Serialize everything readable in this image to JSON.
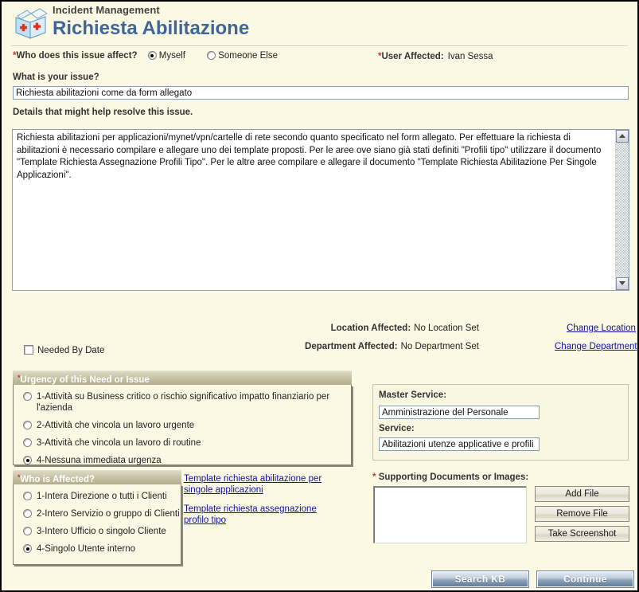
{
  "header": {
    "app_title": "Incident Management",
    "page_title": "Richiesta Abilitazione",
    "logo_icon": "incident-box-icon"
  },
  "affect_row": {
    "question": "Who does this issue affect?",
    "required_star": "*",
    "options": [
      {
        "label": "Myself",
        "selected": true
      },
      {
        "label": "Someone Else",
        "selected": false
      }
    ]
  },
  "user_affected": {
    "required_star": "*",
    "label": "User Affected:",
    "value": "Ivan Sessa"
  },
  "issue": {
    "label": "What is your issue?",
    "value": "Richiesta abilitazioni come da form allegato",
    "placeholder": ""
  },
  "details": {
    "label": "Details that might help resolve this issue.",
    "value": "Richiesta abilitazioni per applicazioni/mynet/vpn/cartelle di rete secondo quanto specificato nel form allegato. Per effettuare la richiesta di abilitazioni è necessario compilare e allegare uno dei template proposti. Per le aree ove siano già stati definiti \"Profili tipo\" utilizzare il documento \"Template Richiesta Assegnazione Profili Tipo\". Per le altre aree compilare e allegare il documento \"Template Richiesta Abilitazione Per Singole Applicazioni\".",
    "scrollbar": {
      "up_icon": "scroll-up-arrow-icon",
      "down_icon": "scroll-down-arrow-icon"
    }
  },
  "location": {
    "label": "Location Affected:",
    "value": "No Location Set",
    "change_link": "Change Location"
  },
  "department": {
    "label": "Department Affected:",
    "value": "No Department Set",
    "change_link": "Change Department"
  },
  "needed_by": {
    "label": "Needed By Date",
    "checked": false
  },
  "urgency": {
    "required_star": "*",
    "title": "Urgency of this Need or Issue",
    "options": [
      {
        "label": "1-Attività su Business critico o rischio significativo impatto finanziario per l'azienda",
        "selected": false
      },
      {
        "label": "2-Attività che vincola un lavoro urgente",
        "selected": false
      },
      {
        "label": "3-Attività che vincola un lavoro di routine",
        "selected": false
      },
      {
        "label": "4-Nessuna immediata urgenza",
        "selected": true
      }
    ]
  },
  "who_affected": {
    "required_star": "*",
    "title": "Who is Affected?",
    "options": [
      {
        "label": "1-Intera Direzione o tutti i Clienti",
        "selected": false
      },
      {
        "label": "2-Intero Servizio o gruppo di Clienti",
        "selected": false
      },
      {
        "label": "3-Intero Ufficio o singolo Cliente",
        "selected": false
      },
      {
        "label": "4-Singolo Utente interno",
        "selected": true
      }
    ]
  },
  "template_links": [
    {
      "line1": "Template richiesta abilitazione per",
      "line2": "singole applicazioni"
    },
    {
      "line1": "Template richiesta assegnazione",
      "line2": "profilo tipo"
    }
  ],
  "service_panel": {
    "master_service_label": "Master Service:",
    "master_service_value": "Amministrazione del Personale",
    "service_label": "Service:",
    "service_value": "Abilitazioni utenze applicative e profili"
  },
  "supporting_documents": {
    "required_star": "*",
    "label": "Supporting Documents or Images:",
    "items": [],
    "buttons": {
      "add_file": "Add File",
      "remove_file": "Remove File",
      "take_screenshot": "Take Screenshot"
    }
  },
  "footer_buttons": {
    "search_kb": "Search KB",
    "continue": "Continue"
  },
  "colors": {
    "page_background": "#fbf8e3",
    "title_blue": "#3f6699",
    "required_red": "#cc3333",
    "link_blue": "#1212a0",
    "panel_header_olive": "#c9c4a7",
    "button_blue": "#5d7897"
  }
}
